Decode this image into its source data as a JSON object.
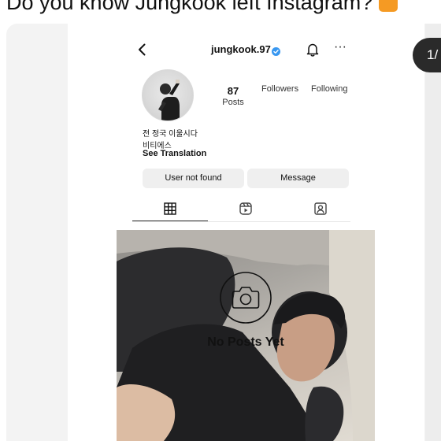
{
  "caption": {
    "text": "Do you know Jungkook left Instagram?",
    "emoji_icon": "orange-emoji-icon"
  },
  "carousel": {
    "counter": "1/"
  },
  "profile": {
    "back_icon": "chevron-left-icon",
    "username": "jungkook.97",
    "verified_icon": "verified-badge-icon",
    "bell_icon": "bell-icon",
    "more_label": "···",
    "stats": {
      "posts_count": "87",
      "posts_label": "Posts",
      "followers_label": "Followers",
      "following_label": "Following"
    },
    "bio": {
      "name": "전 정국 이울시다",
      "subtitle": "비티에스",
      "see_translation": "See Translation"
    },
    "buttons": {
      "user_not_found": "User not found",
      "message": "Message"
    },
    "tabs": [
      "grid-icon",
      "reels-icon",
      "tagged-icon"
    ],
    "empty_state": {
      "icon": "camera-icon",
      "text": "No Posts Yet"
    }
  },
  "colors": {
    "verified_blue": "#3897f0",
    "button_bg": "#efefef",
    "counter_bg": "#2a2a2a",
    "emoji_orange": "#f59a23"
  }
}
